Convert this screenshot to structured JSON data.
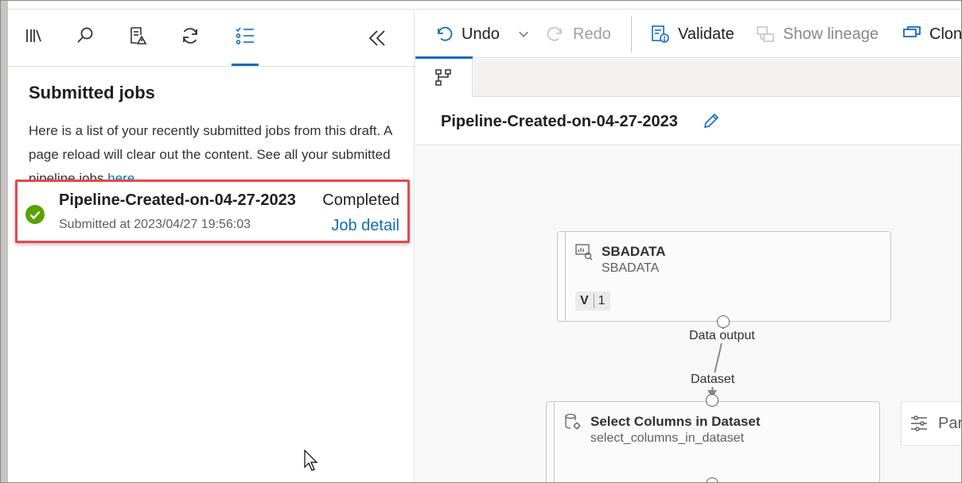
{
  "left_panel": {
    "icons": [
      "library-icon",
      "search-icon",
      "checklist-warning-icon",
      "refresh-icon",
      "submitted-jobs-icon"
    ],
    "title": "Submitted jobs",
    "description": "Here is a list of your recently submitted jobs from this draft. A page reload will clear out the content. See all your submitted pipeline jobs",
    "description_link": "here",
    "job": {
      "name": "Pipeline-Created-on-04-27-2023",
      "submitted": "Submitted at 2023/04/27 19:56:03",
      "status": "Completed",
      "link": "Job detail",
      "status_color": "#57a300"
    }
  },
  "toolbar": {
    "undo": "Undo",
    "redo": "Redo",
    "validate": "Validate",
    "show_lineage": "Show lineage",
    "clone": "Clone"
  },
  "pipeline": {
    "title": "Pipeline-Created-on-04-27-2023"
  },
  "canvas": {
    "node1": {
      "title": "SBADATA",
      "subtitle": "SBADATA",
      "version_label": "V",
      "version": "1",
      "output_port": "Data output"
    },
    "node2": {
      "input_port": "Dataset",
      "title": "Select Columns in Dataset",
      "subtitle": "select_columns_in_dataset"
    },
    "params_label": "Para"
  },
  "colors": {
    "accent": "#0f6cbd",
    "highlight": "#e5484d",
    "success": "#57a300"
  }
}
